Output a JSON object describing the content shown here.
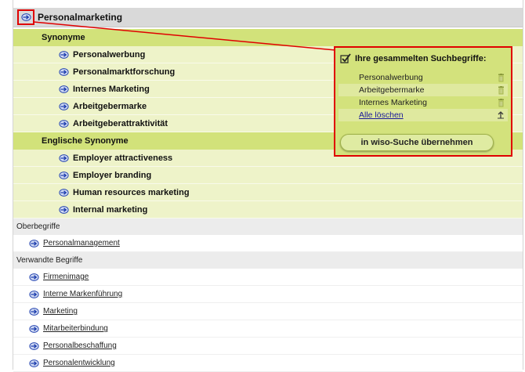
{
  "header": {
    "title": "Personalmarketing"
  },
  "synonyme": {
    "label": "Synonyme",
    "items": [
      "Personalwerbung",
      "Personalmarktforschung",
      "Internes Marketing",
      "Arbeitgebermarke",
      "Arbeitgeberattraktivität"
    ]
  },
  "englische": {
    "label": "Englische Synonyme",
    "items": [
      "Employer attractiveness",
      "Employer branding",
      "Human resources marketing",
      "Internal marketing"
    ]
  },
  "oberbegriffe": {
    "label": "Oberbegriffe",
    "items": [
      "Personalmanagement"
    ]
  },
  "verwandte": {
    "label": "Verwandte Begriffe",
    "items": [
      "Firmenimage",
      "Interne Markenführung",
      "Marketing",
      "Mitarbeiterbindung",
      "Personalbeschaffung",
      "Personalentwicklung"
    ]
  },
  "panel": {
    "title": "Ihre gesammelten Suchbegriffe:",
    "selected": [
      "Personalwerbung",
      "Arbeitgebermarke",
      "Internes Marketing"
    ],
    "delete_all": "Alle löschen",
    "button": "in wiso-Suche übernehmen"
  },
  "colors": {
    "highlight": "#e00000",
    "section_green": "#d2e27a",
    "item_green": "#eef3c9",
    "icon_blue": "#1f3fae"
  }
}
